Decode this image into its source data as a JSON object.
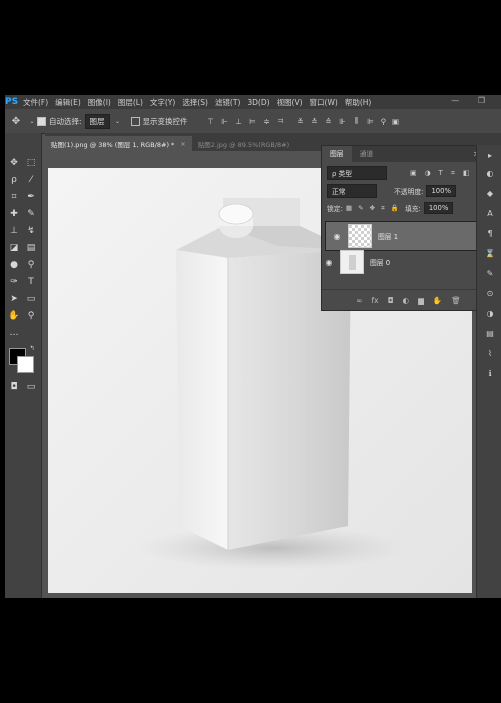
{
  "app": {
    "logo": "PS"
  },
  "menu": [
    "文件(F)",
    "编辑(E)",
    "图像(I)",
    "图层(L)",
    "文字(Y)",
    "选择(S)",
    "滤镜(T)",
    "3D(D)",
    "视图(V)",
    "窗口(W)",
    "帮助(H)"
  ],
  "window_controls": "—  ❐",
  "options": {
    "auto_select_label": "自动选择:",
    "auto_select_value": "图层",
    "show_transform_label": "显示变换控件"
  },
  "tabs": [
    {
      "label": "贴图(1).png @ 38% (图层 1, RGB/8#) *",
      "close": "×"
    },
    {
      "label": "贴图2.jpg @ 89.5%(RGB/8#)"
    }
  ],
  "layers_panel": {
    "tab_layers": "图层",
    "tab_channels": "通道",
    "menu_icon": "≫ ≡",
    "filter_label": "ρ 类型",
    "filter_icons": "▣ ◑ T ⌗ ◧",
    "blend_mode": "正常",
    "opacity_label": "不透明度:",
    "opacity_value": "100%",
    "lock_label": "锁定:",
    "lock_icons": "▦ ✎ ✥ ⌗ 🔒",
    "fill_label": "填充:",
    "fill_value": "100%",
    "layers": [
      {
        "name": "图层 1",
        "selected": true
      },
      {
        "name": "图层 0",
        "selected": false
      }
    ],
    "footer_icons": [
      "∞",
      "fx",
      "◘",
      "◐",
      "▆",
      "✋",
      "🗑"
    ]
  }
}
